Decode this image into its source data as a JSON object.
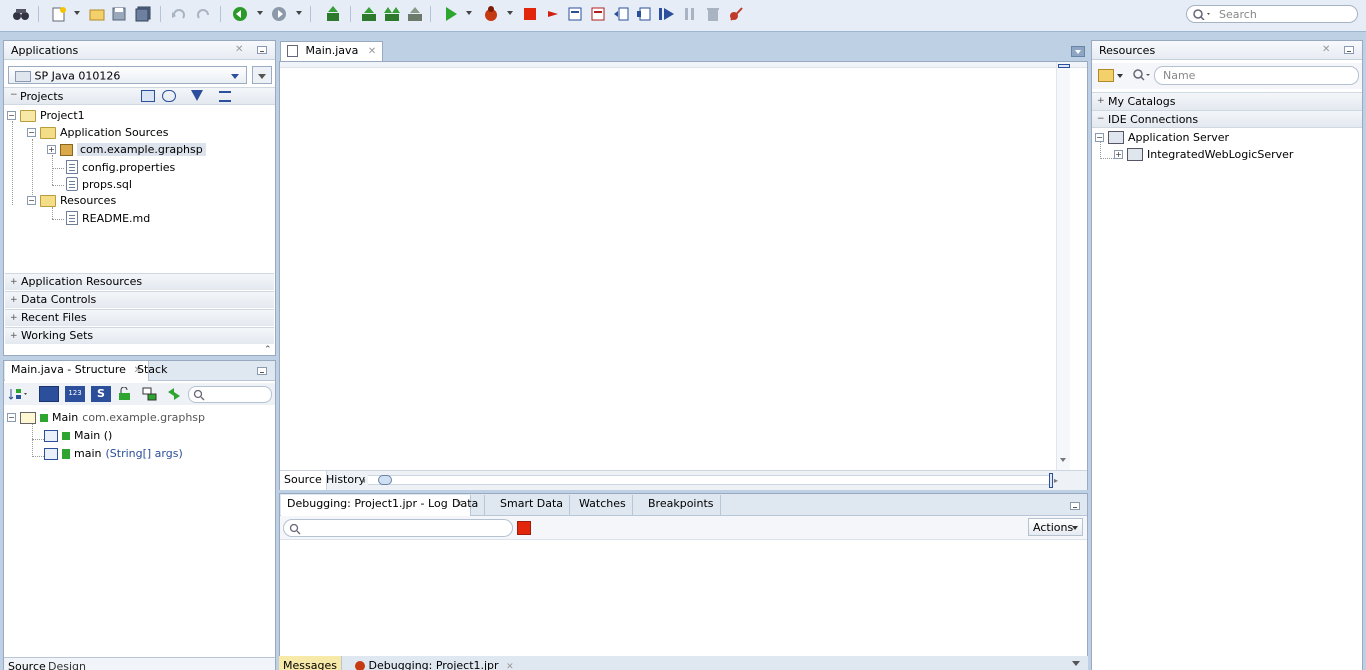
{
  "toolbar": {
    "search_placeholder": "Search",
    "icons": [
      "binoculars-icon",
      "new-icon",
      "open-icon",
      "save-icon",
      "save-all-icon",
      "undo-icon",
      "redo-icon",
      "back-icon",
      "forward-icon",
      "make-icon",
      "rebuild-icon",
      "build-icon",
      "clean-icon",
      "run-icon",
      "debug-icon",
      "terminate-icon",
      "step-over-icon",
      "step-into-icon",
      "step-out-icon",
      "resume-icon",
      "pause-icon",
      "delete-icon",
      "breakpoint-icon"
    ]
  },
  "applications": {
    "title": "Applications",
    "app_selector": "SP Java 010126",
    "projects_label": "Projects",
    "tree": {
      "project": "Project1",
      "app_sources": "Application Sources",
      "package": "com.example.graphsp",
      "config": "config.properties",
      "sql": "props.sql",
      "resources": "Resources",
      "readme": "README.md"
    },
    "accordions": [
      "Application Resources",
      "Data Controls",
      "Recent Files",
      "Working Sets"
    ]
  },
  "structure": {
    "tab_structure": "Main.java - Structure",
    "tab_stack": "Stack",
    "class_name": "Main",
    "class_pkg": "com.example.graphsp",
    "ctor": "Main ()",
    "method_name": "main",
    "method_params": "(String[] args)",
    "bottom_tabs": [
      "Source",
      "Design"
    ]
  },
  "editor": {
    "tab": "Main.java",
    "bottom_tabs": [
      "Source",
      "History"
    ]
  },
  "log": {
    "tabs": [
      "Debugging: Project1.jpr - Log",
      "Data",
      "Smart Data",
      "Watches",
      "Breakpoints"
    ],
    "actions": "Actions",
    "bottom_tabs": [
      "Messages",
      "Debugging: Project1.jpr"
    ]
  },
  "resources": {
    "title": "Resources",
    "search_placeholder": "Name",
    "my_catalogs": "My Catalogs",
    "ide_connections": "IDE Connections",
    "app_server": "Application Server",
    "server": "IntegratedWebLogicServer"
  }
}
